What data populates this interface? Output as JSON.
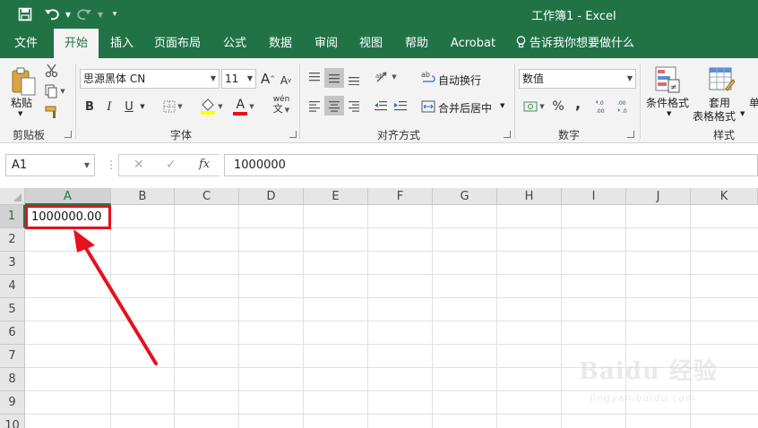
{
  "titlebar": {
    "title": "工作簿1  -   Excel",
    "undo_icon": "undo-icon",
    "redo_icon": "redo-icon",
    "save_icon": "save-icon"
  },
  "tabs": [
    "文件",
    "开始",
    "插入",
    "页面布局",
    "公式",
    "数据",
    "审阅",
    "视图",
    "帮助",
    "Acrobat"
  ],
  "active_tab": "开始",
  "tell_me": "告诉我你想要做什么",
  "ribbon": {
    "clipboard": {
      "paste_label": "粘贴",
      "group_label": "剪贴板"
    },
    "font": {
      "font_name": "思源黑体 CN",
      "font_size": "11",
      "bold": "B",
      "italic": "I",
      "underline": "U",
      "group_label": "字体",
      "grow_font": "A",
      "shrink_font": "A",
      "font_color": "A",
      "phonetic": "wén"
    },
    "alignment": {
      "wrap_text": "自动换行",
      "merge_center": "合并后居中",
      "group_label": "对齐方式"
    },
    "number": {
      "format": "数值",
      "percent": "%",
      "comma": ",",
      "group_label": "数字"
    },
    "styles": {
      "conditional_format": "条件格式",
      "format_table_line1": "套用",
      "format_table_line2": "表格格式",
      "cell_styles_partial": "单",
      "group_label": "样式"
    }
  },
  "formula_bar": {
    "name_box": "A1",
    "cancel": "✕",
    "enter": "✓",
    "fx": "fx",
    "content": "1000000"
  },
  "sheet": {
    "columns": [
      "A",
      "B",
      "C",
      "D",
      "E",
      "F",
      "G",
      "H",
      "I",
      "J",
      "K"
    ],
    "rows": [
      "1",
      "2",
      "3",
      "4",
      "5",
      "6",
      "7",
      "8",
      "9",
      "10"
    ],
    "cell_a1": "1000000.00"
  },
  "colors": {
    "excel_green": "#217346",
    "annotation_red": "#e8101e"
  },
  "watermark": {
    "brand": "Baidu 经验",
    "sub": "jingyan.baidu.com"
  }
}
